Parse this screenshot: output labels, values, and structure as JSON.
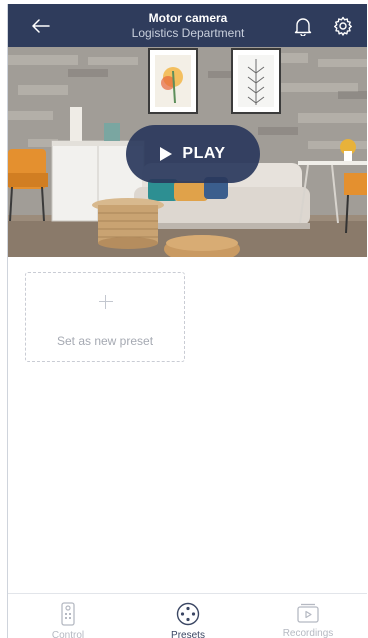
{
  "header": {
    "title": "Motor camera",
    "subtitle": "Logistics Department",
    "back_icon": "arrow-left-icon",
    "bell_icon": "bell-icon",
    "settings_icon": "gear-icon"
  },
  "video": {
    "play_label": "PLAY",
    "play_icon": "play-icon"
  },
  "presets": {
    "new_preset_label": "Set as new preset",
    "add_icon": "plus-icon"
  },
  "bottom_nav": {
    "items": [
      {
        "label": "Control",
        "icon": "remote-control-icon",
        "active": false
      },
      {
        "label": "Presets",
        "icon": "preset-dots-icon",
        "active": true
      },
      {
        "label": "Recordings",
        "icon": "recordings-icon",
        "active": false
      }
    ]
  },
  "colors": {
    "header_bg": "#2f3c5c",
    "play_button_bg": "#2a385c",
    "active_nav": "#3a4663",
    "inactive_nav": "#b5b9c2"
  }
}
